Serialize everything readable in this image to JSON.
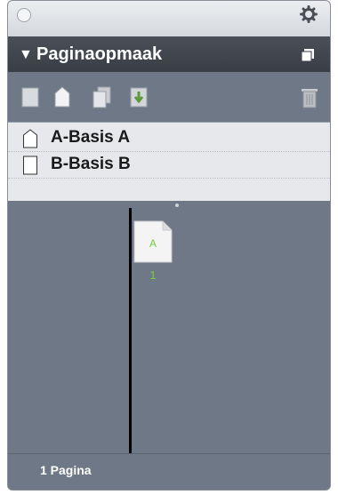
{
  "panel": {
    "title": "Paginaopmaak",
    "collapse_glyph": "▼"
  },
  "icons": {
    "close": "close-circle-icon",
    "gear": "gear-icon",
    "panel_menu": "panel-menu-icon",
    "toolbar": [
      "new-document-icon",
      "master-page-icon",
      "duplicate-page-icon",
      "insert-page-icon",
      "trash-icon"
    ]
  },
  "masters": [
    {
      "label": "A-Basis A",
      "icon": "master-page-icon"
    },
    {
      "label": "B-Basis B",
      "icon": "blank-page-icon"
    }
  ],
  "pages": [
    {
      "master_letter": "A",
      "page_number": "1"
    }
  ],
  "status": {
    "page_count": "1 Pagina"
  },
  "colors": {
    "panel_bg": "#6f7886",
    "title_bg": "#3f434b",
    "masters_bg": "#e7e8eb",
    "page_number": "#6fcf3c"
  }
}
